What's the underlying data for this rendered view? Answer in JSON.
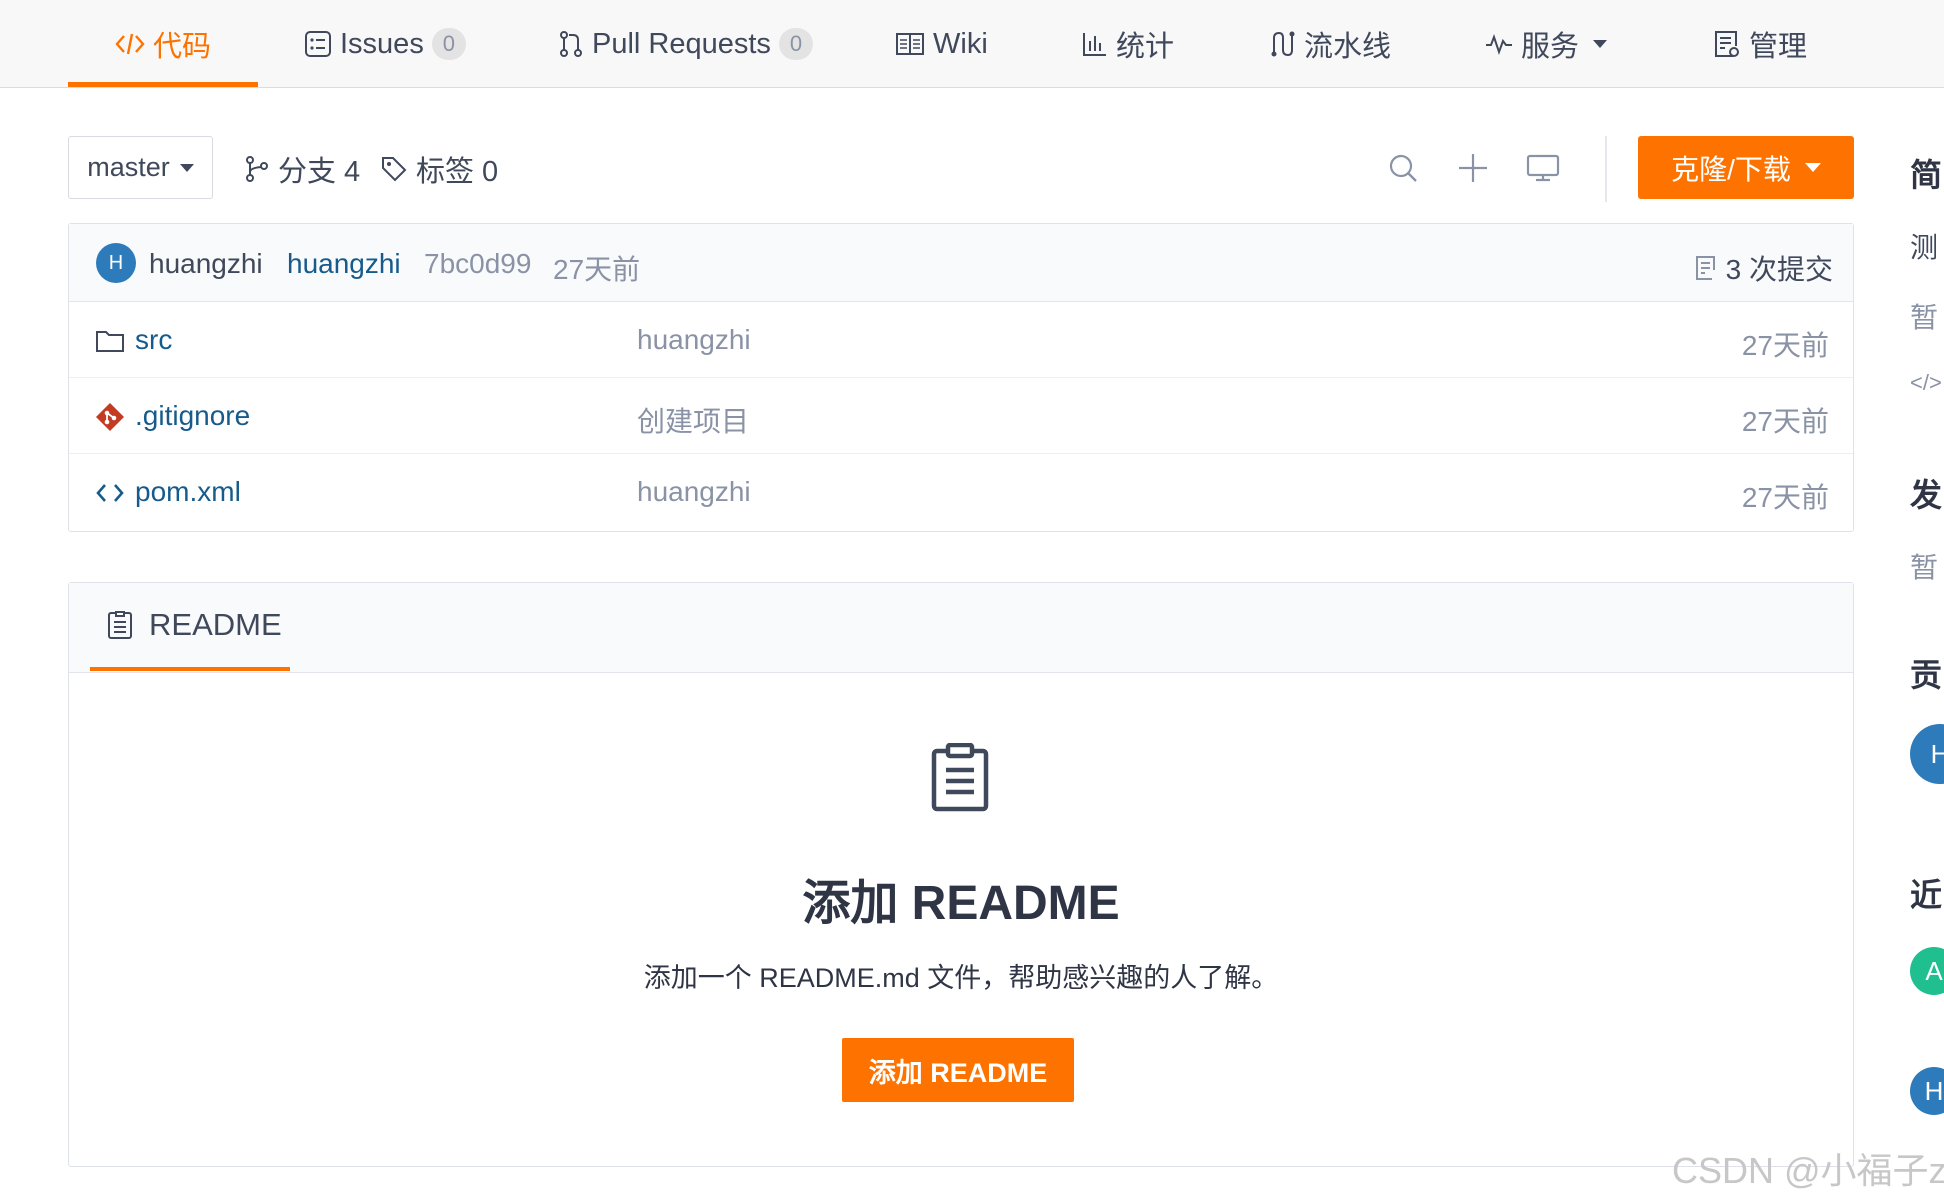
{
  "nav": {
    "tabs": [
      {
        "label": "代码",
        "icon": "code-icon",
        "active": true
      },
      {
        "label": "Issues",
        "icon": "issues-icon",
        "count": "0"
      },
      {
        "label": "Pull Requests",
        "icon": "pull-request-icon",
        "count": "0"
      },
      {
        "label": "Wiki",
        "icon": "wiki-icon"
      },
      {
        "label": "统计",
        "icon": "stats-icon"
      },
      {
        "label": "流水线",
        "icon": "pipeline-icon"
      },
      {
        "label": "服务",
        "icon": "service-icon",
        "dropdown": true
      },
      {
        "label": "管理",
        "icon": "manage-icon"
      }
    ]
  },
  "toolbar": {
    "branch": "master",
    "branches": "分支 4",
    "tags": "标签 0",
    "clone_label": "克隆/下载"
  },
  "commit": {
    "avatar_letter": "H",
    "author": "huangzhi",
    "message": "huangzhi",
    "hash": "7bc0d99",
    "time": "27天前",
    "count_label": "3 次提交"
  },
  "files": [
    {
      "name": "src",
      "icon": "folder-icon",
      "message": "huangzhi",
      "time": "27天前"
    },
    {
      "name": ".gitignore",
      "icon": "git-icon",
      "message": "创建项目",
      "time": "27天前"
    },
    {
      "name": "pom.xml",
      "icon": "code-file-icon",
      "message": "huangzhi",
      "time": "27天前"
    }
  ],
  "readme": {
    "tab_label": "README",
    "title": "添加 README",
    "description": "添加一个 README.md 文件，帮助感兴趣的人了解。",
    "button_label": "添加 README"
  },
  "sidebar": {
    "intro_head": "简",
    "intro_text": "测",
    "intro_empty": "暂",
    "code_symbol": "</>",
    "release_head": "发",
    "release_empty": "暂",
    "contrib_head": "贡",
    "contrib_avatar": "H",
    "recent_head": "近",
    "recent_avatar_1": "A",
    "recent_avatar_2": "H"
  },
  "colors": {
    "accent": "#fe7300",
    "link": "#165b8c",
    "avatar_blue": "#2d7bbb",
    "avatar_green": "#1fbf8f"
  },
  "watermark": "CSDN @小福子z"
}
